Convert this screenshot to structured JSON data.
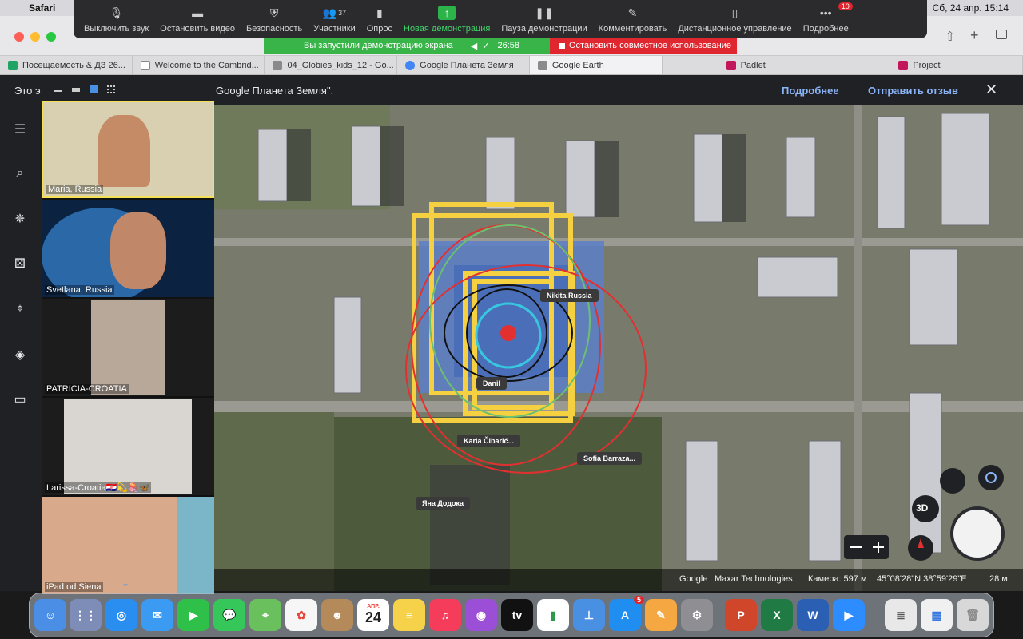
{
  "menubar": {
    "app": "Safari",
    "datetime": "Сб, 24 апр.  15:14"
  },
  "zoom_toolbar": {
    "buttons": [
      {
        "label": "Выключить звук",
        "icon": "microphone-icon"
      },
      {
        "label": "Остановить видео",
        "icon": "video-camera-icon"
      },
      {
        "label": "Безопасность",
        "icon": "shield-icon"
      },
      {
        "label": "Участники",
        "icon": "participants-icon",
        "count": "37"
      },
      {
        "label": "Опрос",
        "icon": "poll-icon"
      },
      {
        "label": "Новая демонстрация",
        "icon": "share-screen-icon"
      },
      {
        "label": "Пауза демонстрации",
        "icon": "pause-icon"
      },
      {
        "label": "Комментировать",
        "icon": "pencil-icon"
      },
      {
        "label": "Дистанционное управление",
        "icon": "mouse-icon"
      },
      {
        "label": "Подробнее",
        "icon": "more-icon",
        "badge": "10"
      }
    ],
    "share_status": "Вы запустили демонстрацию экрана",
    "share_timer": "26:58",
    "stop_share": "Остановить совместное использование"
  },
  "tabs": [
    {
      "label": "Посещаемость & ДЗ 26...",
      "color": "#1fa463"
    },
    {
      "label": "Welcome to the Cambrid...",
      "color": "#7a7a7a"
    },
    {
      "label": "04_Globies_kids_12 - Go...",
      "color": "#8a8a8a"
    },
    {
      "label": "Google Планета Земля",
      "color": "#4285f4"
    },
    {
      "label": "Google Earth",
      "color": "#8a8a8a"
    },
    {
      "label": "Padlet",
      "color": "#c2185b"
    },
    {
      "label": "Project",
      "color": "#c2185b"
    }
  ],
  "ge_header": {
    "notice_prefix": "Это э",
    "notice_suffix": "Google Планета Земля\".",
    "more": "Подробнее",
    "feedback": "Отправить отзыв"
  },
  "ge_footer": {
    "google": "Google",
    "provider": "Maxar Technologies",
    "camera": "Камера: 597 м",
    "coords": "45°08'28\"N 38°59'29\"E",
    "scale": "28 м"
  },
  "map_controls": {
    "three_d": "3D"
  },
  "annotations": [
    "Nikita Russia",
    "Danil",
    "Karla Čibarić...",
    "Sofia Barraza...",
    "Яна Додока"
  ],
  "participants": [
    {
      "name": "Maria, Russia"
    },
    {
      "name": "Svetlana, Russia"
    },
    {
      "name": "PATRICIA-CROATIA"
    },
    {
      "name": "Larissa-Croatia🇭🇷💫🪼🦋"
    },
    {
      "name": "iPad od Siena"
    }
  ],
  "dock": {
    "calendar_month": "АПР.",
    "calendar_day": "24",
    "appstore_badge": "5"
  }
}
